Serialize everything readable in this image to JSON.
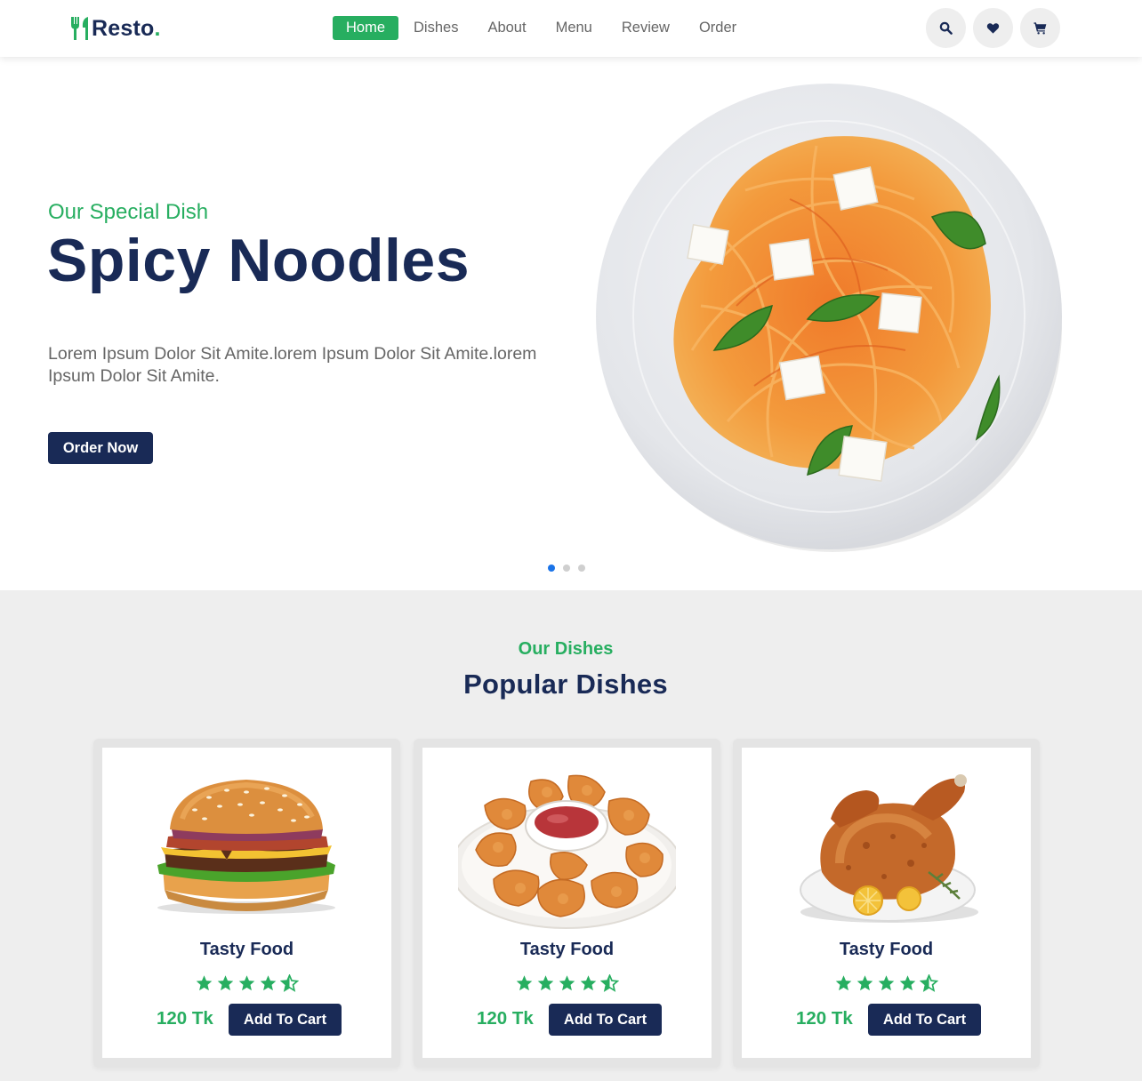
{
  "brand": {
    "name": "Resto",
    "dot": ".",
    "accent": "#27ae60",
    "primary": "#192a56"
  },
  "nav": {
    "items": [
      {
        "label": "Home",
        "active": true
      },
      {
        "label": "Dishes"
      },
      {
        "label": "About"
      },
      {
        "label": "Menu"
      },
      {
        "label": "Review"
      },
      {
        "label": "Order"
      }
    ]
  },
  "header_icons": [
    "search-icon",
    "heart-icon",
    "cart-icon"
  ],
  "hero": {
    "subtitle": "Our Special Dish",
    "title": "Spicy Noodles",
    "description": "Lorem Ipsum Dolor Sit Amite.lorem Ipsum Dolor Sit Amite.lorem Ipsum Dolor Sit Amite.",
    "button": "Order Now",
    "slides": 3,
    "active_slide": 1
  },
  "dishes_section": {
    "subtitle": "Our Dishes",
    "title": "Popular Dishes",
    "cards": [
      {
        "name": "Tasty Food",
        "rating": 4.5,
        "price": "120 Tk",
        "button": "Add To Cart",
        "image": "burger"
      },
      {
        "name": "Tasty Food",
        "rating": 4.5,
        "price": "120 Tk",
        "button": "Add To Cart",
        "image": "nuggets"
      },
      {
        "name": "Tasty Food",
        "rating": 4.5,
        "price": "120 Tk",
        "button": "Add To Cart",
        "image": "roast-chicken"
      }
    ]
  }
}
